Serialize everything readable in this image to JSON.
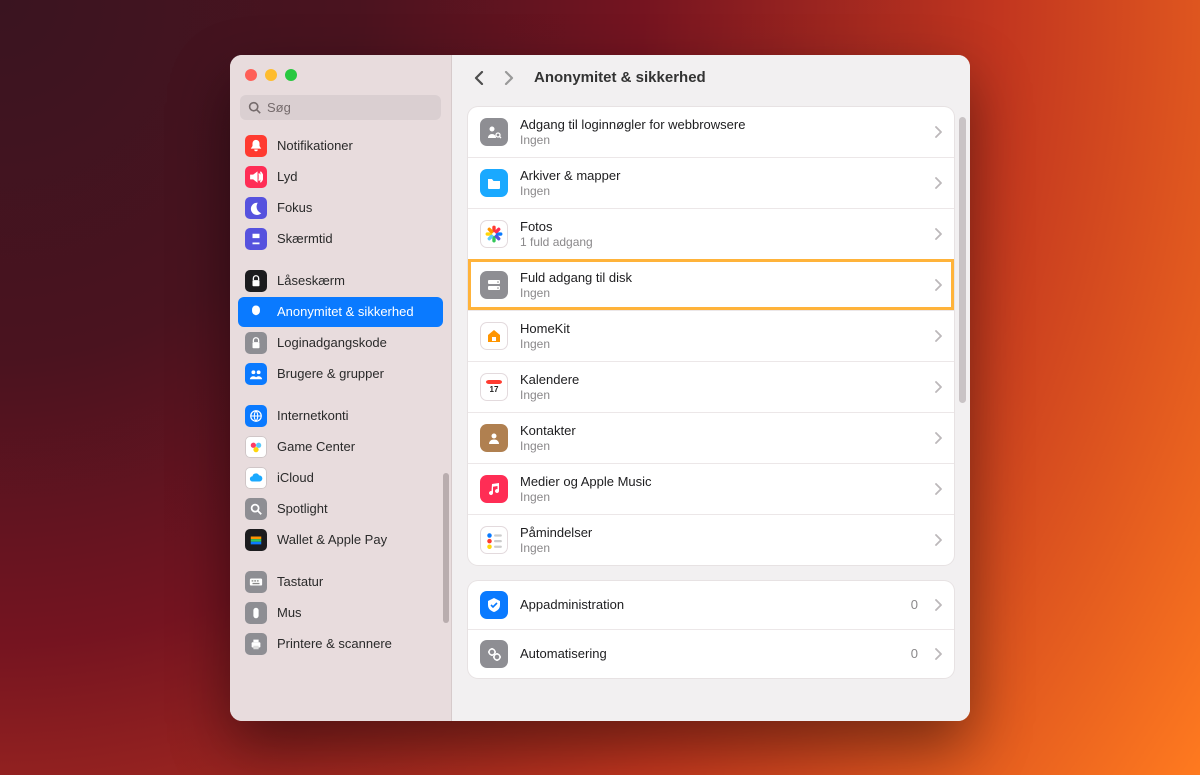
{
  "search": {
    "placeholder": "Søg"
  },
  "title": "Anonymitet & sikkerhed",
  "sidebar": [
    {
      "group": [
        {
          "id": "notifications",
          "label": "Notifikationer",
          "color": "#ff3b30"
        },
        {
          "id": "sound",
          "label": "Lyd",
          "color": "#ff2d55"
        },
        {
          "id": "focus",
          "label": "Fokus",
          "color": "#5652de"
        },
        {
          "id": "screentime",
          "label": "Skærmtid",
          "color": "#5652de"
        }
      ]
    },
    {
      "group": [
        {
          "id": "lockscreen",
          "label": "Låseskærm",
          "color": "#1c1c1e"
        },
        {
          "id": "privacy",
          "label": "Anonymitet & sikkerhed",
          "color": "#0a7aff",
          "selected": true
        },
        {
          "id": "loginpwd",
          "label": "Loginadgangskode",
          "color": "#8e8e93"
        },
        {
          "id": "users",
          "label": "Brugere & grupper",
          "color": "#0a7aff"
        }
      ]
    },
    {
      "group": [
        {
          "id": "internetacc",
          "label": "Internetkonti",
          "color": "#0a7aff"
        },
        {
          "id": "gamecenter",
          "label": "Game Center",
          "color": "#ffffff"
        },
        {
          "id": "icloud",
          "label": "iCloud",
          "color": "#ffffff"
        },
        {
          "id": "spotlight",
          "label": "Spotlight",
          "color": "#8e8e93"
        },
        {
          "id": "wallet",
          "label": "Wallet & Apple Pay",
          "color": "#1c1c1e"
        }
      ]
    },
    {
      "group": [
        {
          "id": "keyboard",
          "label": "Tastatur",
          "color": "#8e8e93"
        },
        {
          "id": "mouse",
          "label": "Mus",
          "color": "#8e8e93"
        },
        {
          "id": "printers",
          "label": "Printere & scannere",
          "color": "#8e8e93"
        }
      ]
    }
  ],
  "groups": [
    [
      {
        "id": "webkeys",
        "title": "Adgang til loginnøgler for webbrowsere",
        "sub": "Ingen",
        "color": "#8e8e93"
      },
      {
        "id": "filesfolders",
        "title": "Arkiver & mapper",
        "sub": "Ingen",
        "color": "#1aa9ff"
      },
      {
        "id": "photos",
        "title": "Fotos",
        "sub": "1 fuld adgang",
        "color": "#ffffff"
      },
      {
        "id": "fulldisk",
        "title": "Fuld adgang til disk",
        "sub": "Ingen",
        "color": "#8e8e93",
        "highlight": true
      },
      {
        "id": "homekit",
        "title": "HomeKit",
        "sub": "Ingen",
        "color": "#ffffff"
      },
      {
        "id": "calendars",
        "title": "Kalendere",
        "sub": "Ingen",
        "color": "#ffffff"
      },
      {
        "id": "contacts",
        "title": "Kontakter",
        "sub": "Ingen",
        "color": "#b08050"
      },
      {
        "id": "media",
        "title": "Medier og Apple Music",
        "sub": "Ingen",
        "color": "#ff2d55"
      },
      {
        "id": "reminders",
        "title": "Påmindelser",
        "sub": "Ingen",
        "color": "#ffffff"
      }
    ],
    [
      {
        "id": "appmgmt",
        "title": "Appadministration",
        "badge": "0",
        "color": "#0a7aff"
      },
      {
        "id": "automation",
        "title": "Automatisering",
        "badge": "0",
        "color": "#8e8e93"
      }
    ]
  ]
}
